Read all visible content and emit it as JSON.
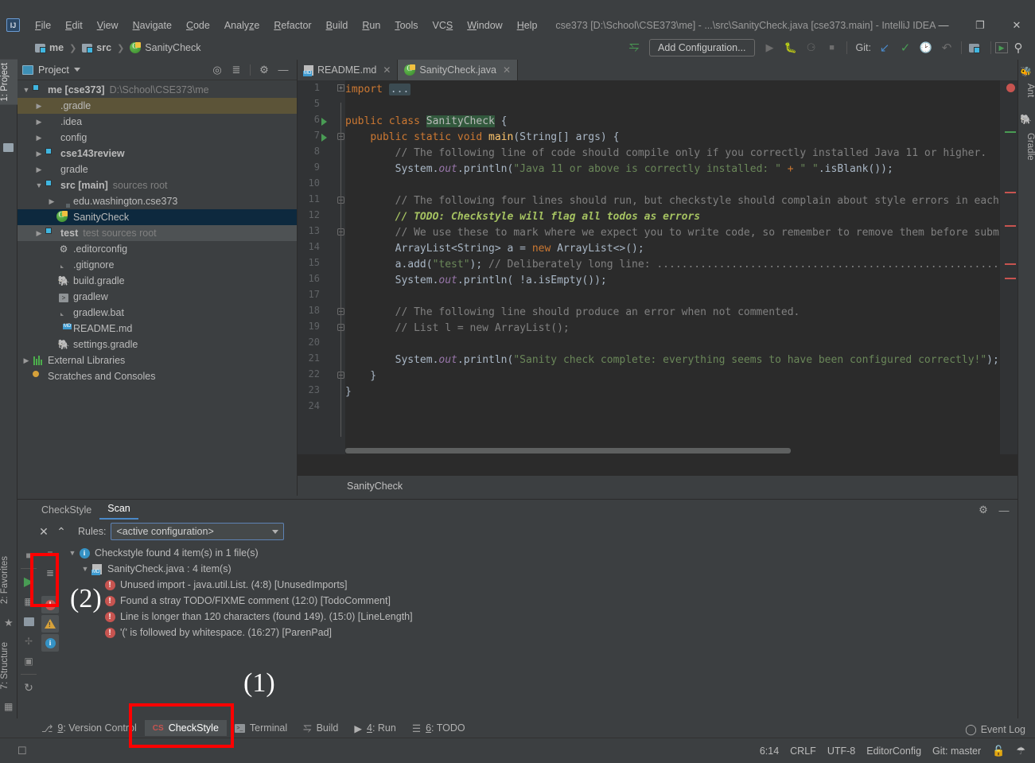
{
  "window": {
    "title": "cse373 [D:\\School\\CSE373\\me] - ...\\src\\SanityCheck.java [cse373.main] - IntelliJ IDEA",
    "logo": "IJ",
    "minimize": "—",
    "maximize": "❐",
    "close": "✕"
  },
  "menu": [
    "File",
    "Edit",
    "View",
    "Navigate",
    "Code",
    "Analyze",
    "Refactor",
    "Build",
    "Run",
    "Tools",
    "VCS",
    "Window",
    "Help"
  ],
  "breadcrumbs": [
    {
      "label": "me",
      "icon": "folder-icon"
    },
    {
      "label": "src",
      "icon": "folder-icon"
    },
    {
      "label": "SanityCheck",
      "icon": "java-class-icon"
    }
  ],
  "toolbar": {
    "build_icon": "hammer-icon",
    "add_configuration": "Add Configuration...",
    "run_icon": "run-icon",
    "debug_icon": "debug-icon",
    "coverage_icon": "run-with-coverage-icon",
    "stop_icon": "stop-icon",
    "git_label": "Git:",
    "update_icon": "update-project-icon",
    "commit_icon": "commit-checkmark-icon",
    "history_icon": "history-icon",
    "rollback_icon": "rollback-icon",
    "project_structure_icon": "project-structure-icon",
    "layout_icon": "layout-icon",
    "search_icon": "search-icon"
  },
  "left_strip": [
    {
      "label": "1: Project",
      "active": true
    },
    {
      "label": "2: Favorites",
      "active": false
    },
    {
      "label": "7: Structure",
      "active": false
    }
  ],
  "right_strip": [
    {
      "label": "Ant",
      "icon": "ant-icon"
    },
    {
      "label": "Gradle",
      "icon": "gradle-elephant-icon"
    }
  ],
  "project_panel": {
    "title": "Project",
    "caret": "▾",
    "icons": [
      "locate-icon",
      "collapse-all-icon",
      "gear-icon",
      "hide-icon"
    ],
    "tree": [
      {
        "indent": 0,
        "arrow": "▼",
        "icon": "module-folder-icon",
        "label": "me [cse373]",
        "bold": true,
        "sub": "D:\\School\\CSE373\\me",
        "state": "none"
      },
      {
        "indent": 1,
        "arrow": "▶",
        "icon": "folder-orange-icon",
        "label": ".gradle",
        "bold": false,
        "sub": "",
        "state": "olive"
      },
      {
        "indent": 1,
        "arrow": "▶",
        "icon": "folder-icon",
        "label": ".idea",
        "bold": false,
        "sub": "",
        "state": "none"
      },
      {
        "indent": 1,
        "arrow": "▶",
        "icon": "folder-icon",
        "label": "config",
        "bold": false,
        "sub": "",
        "state": "none"
      },
      {
        "indent": 1,
        "arrow": "▶",
        "icon": "module-folder-icon",
        "label": "cse143review",
        "bold": true,
        "sub": "",
        "state": "none"
      },
      {
        "indent": 1,
        "arrow": "▶",
        "icon": "folder-icon",
        "label": "gradle",
        "bold": false,
        "sub": "",
        "state": "none"
      },
      {
        "indent": 1,
        "arrow": "▼",
        "icon": "module-folder-icon",
        "label": "src [main]",
        "bold": true,
        "sub": "sources root",
        "state": "none"
      },
      {
        "indent": 2,
        "arrow": "▶",
        "icon": "package-icon",
        "label": "edu.washington.cse373",
        "bold": false,
        "sub": "",
        "state": "none"
      },
      {
        "indent": 2,
        "arrow": "",
        "icon": "java-class-icon",
        "label": "SanityCheck",
        "bold": false,
        "sub": "",
        "state": "blue"
      },
      {
        "indent": 1,
        "arrow": "▶",
        "icon": "module-folder-icon",
        "label": "test",
        "bold": true,
        "sub": "test sources root",
        "state": "gray"
      },
      {
        "indent": 2,
        "arrow": "",
        "icon": "gear-icon",
        "label": ".editorconfig",
        "bold": false,
        "sub": "",
        "state": "none"
      },
      {
        "indent": 2,
        "arrow": "",
        "icon": "gitignore-icon",
        "label": ".gitignore",
        "bold": false,
        "sub": "",
        "state": "none"
      },
      {
        "indent": 2,
        "arrow": "",
        "icon": "gradle-elephant-icon",
        "label": "build.gradle",
        "bold": false,
        "sub": "",
        "state": "none"
      },
      {
        "indent": 2,
        "arrow": "",
        "icon": "shell-script-icon",
        "label": "gradlew",
        "bold": false,
        "sub": "",
        "state": "none"
      },
      {
        "indent": 2,
        "arrow": "",
        "icon": "file-icon",
        "label": "gradlew.bat",
        "bold": false,
        "sub": "",
        "state": "none"
      },
      {
        "indent": 2,
        "arrow": "",
        "icon": "markdown-icon",
        "label": "README.md",
        "bold": false,
        "sub": "",
        "state": "none"
      },
      {
        "indent": 2,
        "arrow": "",
        "icon": "gradle-elephant-icon",
        "label": "settings.gradle",
        "bold": false,
        "sub": "",
        "state": "none"
      },
      {
        "indent": 0,
        "arrow": "▶",
        "icon": "library-icon",
        "label": "External Libraries",
        "bold": false,
        "sub": "",
        "state": "none"
      },
      {
        "indent": 0,
        "arrow": "",
        "icon": "scratches-icon",
        "label": "Scratches and Consoles",
        "bold": false,
        "sub": "",
        "state": "none"
      }
    ]
  },
  "editor": {
    "tabs": [
      {
        "label": "README.md",
        "icon": "markdown-icon",
        "active": false,
        "close": "✕"
      },
      {
        "label": "SanityCheck.java",
        "icon": "java-class-icon",
        "active": true,
        "close": "✕"
      }
    ],
    "line_numbers": [
      "1",
      "5",
      "6",
      "7",
      "8",
      "9",
      "10",
      "11",
      "12",
      "13",
      "14",
      "15",
      "16",
      "17",
      "18",
      "19",
      "20",
      "21",
      "22",
      "23",
      "24"
    ],
    "breadcrumb": "SanityCheck",
    "code_lines": [
      {
        "n": "1",
        "segments": [
          {
            "t": "import ",
            "c": "k"
          },
          {
            "t": "...",
            "c": "folded"
          }
        ]
      },
      {
        "n": "5",
        "segments": []
      },
      {
        "n": "6",
        "segments": [
          {
            "t": "public ",
            "c": "k"
          },
          {
            "t": "class ",
            "c": "k"
          },
          {
            "t": "SanityCheck",
            "c": "hl-class"
          },
          {
            "t": " {",
            "c": "n"
          }
        ]
      },
      {
        "n": "7",
        "segments": [
          {
            "t": "    ",
            "c": "n"
          },
          {
            "t": "public static void ",
            "c": "k"
          },
          {
            "t": "main",
            "c": "f"
          },
          {
            "t": "(String[] args) {",
            "c": "n"
          }
        ]
      },
      {
        "n": "8",
        "segments": [
          {
            "t": "        // The following line of code should compile only if you correctly installed Java 11 or higher.",
            "c": "c"
          }
        ]
      },
      {
        "n": "9",
        "segments": [
          {
            "t": "        System.",
            "c": "n"
          },
          {
            "t": "out",
            "c": "fld"
          },
          {
            "t": ".println(",
            "c": "n"
          },
          {
            "t": "\"Java 11 or above is correctly installed: \"",
            "c": "s"
          },
          {
            "t": " + ",
            "c": "k"
          },
          {
            "t": "\" \"",
            "c": "s"
          },
          {
            "t": ".isBlank());",
            "c": "n"
          }
        ]
      },
      {
        "n": "10",
        "segments": []
      },
      {
        "n": "11",
        "segments": [
          {
            "t": "        // The following four lines should run, but checkstyle should complain about style errors in each lines.",
            "c": "c"
          }
        ]
      },
      {
        "n": "12",
        "segments": [
          {
            "t": "        // TODO: Checkstyle will flag all todos as errors",
            "c": "todo"
          }
        ]
      },
      {
        "n": "13",
        "segments": [
          {
            "t": "        // We use these to mark where we expect you to write code, so remember to remove them before submitting.",
            "c": "c"
          }
        ]
      },
      {
        "n": "14",
        "segments": [
          {
            "t": "        ArrayList<String> a = ",
            "c": "n"
          },
          {
            "t": "new ",
            "c": "k"
          },
          {
            "t": "ArrayList<>();",
            "c": "n"
          }
        ]
      },
      {
        "n": "15",
        "segments": [
          {
            "t": "        a.add(",
            "c": "n"
          },
          {
            "t": "\"test\"",
            "c": "s"
          },
          {
            "t": "); ",
            "c": "n"
          },
          {
            "t": "// Deliberately long line: .............................................................................",
            "c": "c"
          }
        ]
      },
      {
        "n": "16",
        "segments": [
          {
            "t": "        System.",
            "c": "n"
          },
          {
            "t": "out",
            "c": "fld"
          },
          {
            "t": ".println( !a.isEmpty());",
            "c": "n"
          }
        ]
      },
      {
        "n": "17",
        "segments": []
      },
      {
        "n": "18",
        "segments": [
          {
            "t": "        // The following line should produce an error when not commented.",
            "c": "c"
          }
        ]
      },
      {
        "n": "19",
        "segments": [
          {
            "t": "        // List l = new ArrayList();",
            "c": "c"
          }
        ]
      },
      {
        "n": "20",
        "segments": []
      },
      {
        "n": "21",
        "segments": [
          {
            "t": "        System.",
            "c": "n"
          },
          {
            "t": "out",
            "c": "fld"
          },
          {
            "t": ".println(",
            "c": "n"
          },
          {
            "t": "\"Sanity check complete: everything seems to have been configured correctly!\"",
            "c": "s"
          },
          {
            "t": ");",
            "c": "n"
          }
        ]
      },
      {
        "n": "22",
        "segments": [
          {
            "t": "    }",
            "c": "n"
          }
        ]
      },
      {
        "n": "23",
        "segments": [
          {
            "t": "}",
            "c": "n"
          }
        ]
      },
      {
        "n": "24",
        "segments": []
      }
    ]
  },
  "checkstyle_panel": {
    "tabs": [
      {
        "label": "CheckStyle",
        "active": false
      },
      {
        "label": "Scan",
        "active": true
      }
    ],
    "close_icon": "close-icon",
    "pin_icon": "pin-icon",
    "rules_label": "Rules:",
    "rules_value": "<active configuration>",
    "settings_icon": "gear-icon",
    "hide_icon": "hide-icon",
    "left_tools": [
      "scroll-to-source-icon",
      "run-scan-icon",
      "scan-module-icon",
      "scan-project-icon",
      "scan-changed-icon",
      "scan-custom-icon",
      "refresh-icon"
    ],
    "right_tools": [
      "expand-all-icon",
      "collapse-all-icon",
      "filter-errors-icon",
      "filter-warnings-icon",
      "filter-info-icon"
    ],
    "results": [
      {
        "indent": 0,
        "arrow": "▼",
        "severity": "info",
        "text": "Checkstyle found 4 item(s) in 1 file(s)"
      },
      {
        "indent": 1,
        "arrow": "▼",
        "severity": "file",
        "text": "SanityCheck.java : 4 item(s)"
      },
      {
        "indent": 2,
        "arrow": "",
        "severity": "error",
        "text": "Unused import - java.util.List. (4:8) [UnusedImports]"
      },
      {
        "indent": 2,
        "arrow": "",
        "severity": "error",
        "text": "Found a stray TODO/FIXME comment (12:0) [TodoComment]"
      },
      {
        "indent": 2,
        "arrow": "",
        "severity": "error",
        "text": "Line is longer than 120 characters (found 149). (15:0) [LineLength]"
      },
      {
        "indent": 2,
        "arrow": "",
        "severity": "error",
        "text": "'(' is followed by whitespace. (16:27) [ParenPad]"
      }
    ]
  },
  "bottom_tabs": [
    {
      "num": "9",
      "label": ": Version Control",
      "icon": "branch-icon",
      "active": false
    },
    {
      "num": "",
      "label": "CheckStyle",
      "icon": "checkstyle-icon",
      "active": true
    },
    {
      "num": "",
      "label": "Terminal",
      "icon": "terminal-icon",
      "active": false
    },
    {
      "num": "",
      "label": "Build",
      "icon": "hammer-icon",
      "active": false
    },
    {
      "num": "4",
      "label": ": Run",
      "icon": "run-icon",
      "active": false
    },
    {
      "num": "6",
      "label": ": TODO",
      "icon": "todo-list-icon",
      "active": false
    }
  ],
  "event_log": {
    "label": "Event Log",
    "icon": "balloon-icon"
  },
  "status_bar": {
    "left_icon": "inspector-icon",
    "caret_position": "6:14",
    "line_separator": "CRLF",
    "encoding": "UTF-8",
    "editorconfig": "EditorConfig",
    "git_branch": "Git: master",
    "lock_icon": "lock-icon",
    "hector_icon": "hector-icon"
  },
  "annotations": [
    {
      "label": "(1)",
      "target": "checkstyle-bottom-tab"
    },
    {
      "label": "(2)",
      "target": "run-scan-button"
    }
  ],
  "colors": {
    "accent_blue": "#4b6eaf",
    "error_red": "#c75450",
    "annotation_red": "#ff0000",
    "selection_blue": "#0d293e",
    "editor_bg": "#2b2b2b",
    "panel_bg": "#3c3f41"
  }
}
